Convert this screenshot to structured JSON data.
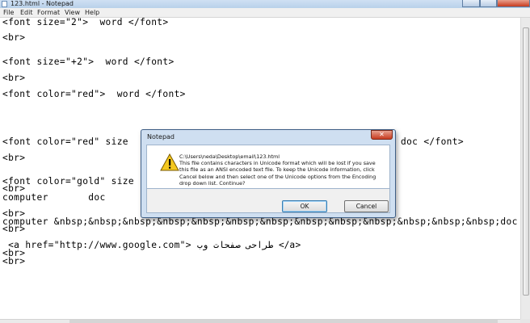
{
  "window": {
    "title": "123.html - Notepad",
    "close_glyph": "✕"
  },
  "menu": {
    "items": [
      "File",
      "Edit",
      "Format",
      "View",
      "Help"
    ]
  },
  "editor": {
    "lines": [
      "<font size=\"2\">  word </font>",
      "<br>",
      "<font size=\"+2\">  word </font>",
      "<br>",
      "<font color=\"red\">  word </font>",
      "<font color=\"red\" size",
      "doc </font>",
      "<br>",
      "<font color=\"gold\" size",
      "<br>",
      "computer       doc",
      "<br>",
      "computer &nbsp;&nbsp;&nbsp;&nbsp;&nbsp;&nbsp;&nbsp;&nbsp;&nbsp;&nbsp;&nbsp;&nbsp;&nbsp;doc",
      "<br>",
      " <a href=\"http://www.google.com\"> طراحی صفحات وب </a>",
      "<br>",
      "<br>"
    ]
  },
  "dialog": {
    "title": "Notepad",
    "close_glyph": "✕",
    "path": "C:\\Users\\neda\\Desktop\\email\\123.html",
    "message": "This file contains characters in Unicode format which will be lost if you save this file as an ANSI encoded text file. To keep the Unicode information, click Cancel below and then select one of the Unicode options from the Encoding drop down list. Continue?",
    "ok_label": "OK",
    "cancel_label": "Cancel",
    "icon": "warning-icon"
  }
}
